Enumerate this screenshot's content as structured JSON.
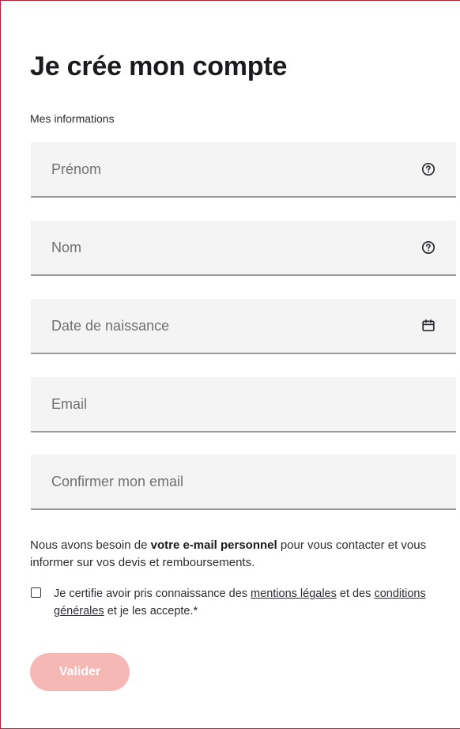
{
  "form": {
    "title": "Je crée mon compte",
    "section_label": "Mes informations",
    "fields": [
      {
        "placeholder": "Prénom",
        "value": "",
        "icon": "help-circle-icon"
      },
      {
        "placeholder": "Nom",
        "value": "",
        "icon": "help-circle-icon"
      },
      {
        "placeholder": "Date de naissance",
        "value": "",
        "icon": "calendar-icon"
      },
      {
        "placeholder": "Email",
        "value": ""
      },
      {
        "placeholder": "Confirmer mon email",
        "value": ""
      }
    ],
    "info": {
      "before": "Nous avons besoin de ",
      "bold": "votre e-mail personnel",
      "after": " pour vous contacter et vous informer sur vos devis et remboursements."
    },
    "consent": {
      "checked": false,
      "part1": "Je certifie avoir pris connaissance des ",
      "link1": "mentions légales",
      "part2": " et des ",
      "link2": "conditions générales",
      "part3": " et je les accepte.*"
    },
    "submit_label": "Valider"
  },
  "colors": {
    "frame_border": "#b0233a",
    "field_background": "#f4f4f4",
    "field_underline": "#9a9a9a",
    "submit_disabled": "#f6b8b5"
  }
}
